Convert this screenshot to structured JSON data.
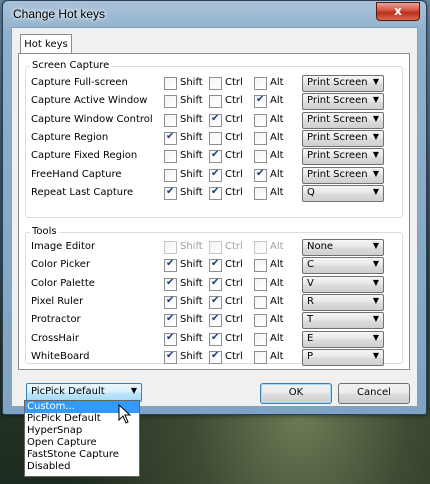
{
  "window": {
    "title": "Change Hot keys",
    "close_glyph": "x"
  },
  "tab": {
    "label": "Hot keys"
  },
  "modifiers": [
    "Shift",
    "Ctrl",
    "Alt"
  ],
  "screen_capture": {
    "title": "Screen Capture",
    "rows": [
      {
        "label": "Capture Full-screen",
        "shift": false,
        "ctrl": false,
        "alt": false,
        "key": "Print Screen"
      },
      {
        "label": "Capture Active Window",
        "shift": false,
        "ctrl": false,
        "alt": true,
        "key": "Print Screen"
      },
      {
        "label": "Capture Window Control",
        "shift": false,
        "ctrl": true,
        "alt": false,
        "key": "Print Screen"
      },
      {
        "label": "Capture Region",
        "shift": true,
        "ctrl": false,
        "alt": false,
        "key": "Print Screen"
      },
      {
        "label": "Capture Fixed Region",
        "shift": false,
        "ctrl": true,
        "alt": false,
        "key": "Print Screen"
      },
      {
        "label": "FreeHand Capture",
        "shift": false,
        "ctrl": true,
        "alt": true,
        "key": "Print Screen"
      },
      {
        "label": "Repeat Last Capture",
        "shift": true,
        "ctrl": true,
        "alt": false,
        "key": "Q"
      }
    ]
  },
  "tools": {
    "title": "Tools",
    "rows": [
      {
        "label": "Image Editor",
        "shift": false,
        "ctrl": false,
        "alt": false,
        "key": "None",
        "disabled": true
      },
      {
        "label": "Color Picker",
        "shift": true,
        "ctrl": true,
        "alt": false,
        "key": "C"
      },
      {
        "label": "Color Palette",
        "shift": true,
        "ctrl": true,
        "alt": false,
        "key": "V"
      },
      {
        "label": "Pixel Ruler",
        "shift": true,
        "ctrl": true,
        "alt": false,
        "key": "R"
      },
      {
        "label": "Protractor",
        "shift": true,
        "ctrl": true,
        "alt": false,
        "key": "T"
      },
      {
        "label": "CrossHair",
        "shift": true,
        "ctrl": true,
        "alt": false,
        "key": "E"
      },
      {
        "label": "WhiteBoard",
        "shift": true,
        "ctrl": true,
        "alt": false,
        "key": "P"
      }
    ]
  },
  "preset": {
    "value": "PicPick Default",
    "options": [
      "Custom...",
      "PicPick Default",
      "HyperSnap",
      "Open Capture",
      "FastStone Capture",
      "Disabled"
    ],
    "highlighted": "Custom..."
  },
  "buttons": {
    "ok": "OK",
    "cancel": "Cancel"
  },
  "icons": {
    "dropdown_arrow": "chevron-down-icon",
    "cursor": "mouse-pointer-icon"
  }
}
